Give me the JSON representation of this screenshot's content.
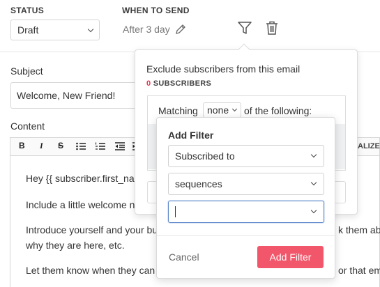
{
  "settings": {
    "status_label": "STATUS",
    "status_value": "Draft",
    "when_label": "WHEN TO SEND",
    "when_value": "After 3 day"
  },
  "form": {
    "subject_label": "Subject",
    "subject_value": "Welcome, New Friend!",
    "content_label": "Content"
  },
  "toolbar": {
    "bold": "B",
    "italic": "I",
    "strike": "S",
    "capitalize": "ALIZE"
  },
  "editor": {
    "line1": "Hey {{ subscriber.first_na",
    "line2": "Include a little welcome n",
    "line3": "Introduce yourself and your bu",
    "line3b": "k them ab",
    "line4": "why they are here, etc.",
    "line5": "Let them know when they can",
    "line5b": "or that em"
  },
  "exclude_popover": {
    "title": "Exclude subscribers from this email",
    "count": "0",
    "count_label": "SUBSCRIBERS",
    "matching_prefix": "Matching",
    "matching_value": "none",
    "matching_suffix": "of the following:"
  },
  "add_filter": {
    "title": "Add Filter",
    "field1": "Subscribed to",
    "field2": "sequences",
    "field3": "",
    "cancel_label": "Cancel",
    "submit_label": "Add Filter"
  },
  "colors": {
    "accent": "#f2566a",
    "count": "#e8384f",
    "focus": "#5b86c9"
  }
}
